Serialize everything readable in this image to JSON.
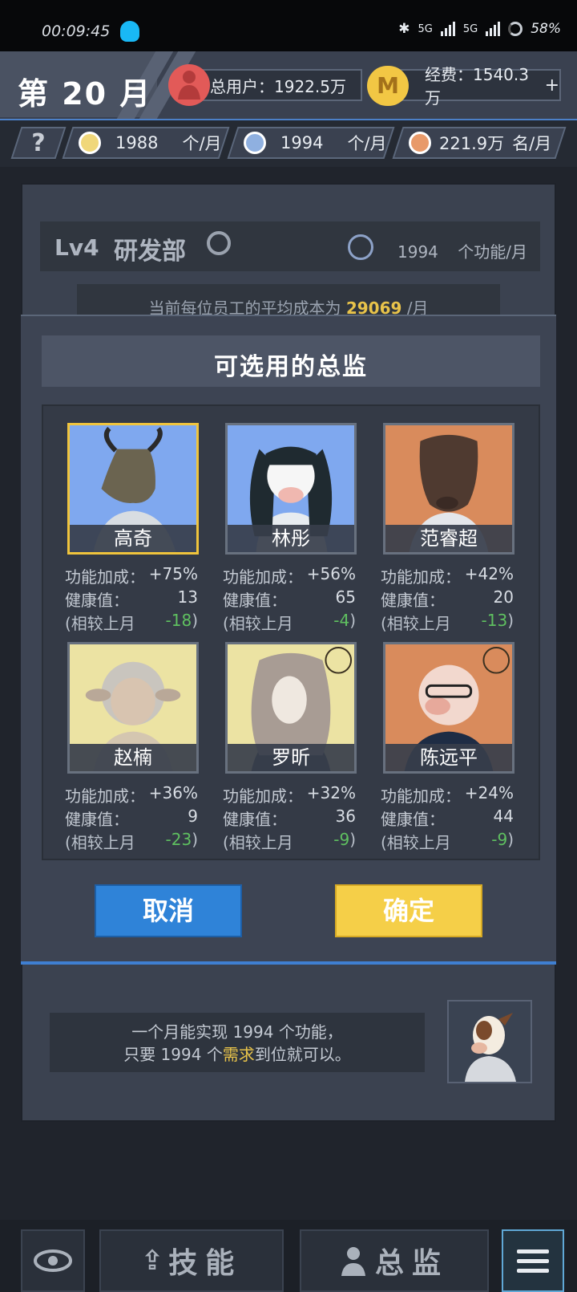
{
  "status_bar": {
    "time": "00:09:45",
    "network1": "5G",
    "network2": "5G",
    "battery": "58%"
  },
  "header": {
    "month": "第 20 月",
    "total_users": "总用户：1922.5万",
    "funds": "经费：1540.3万",
    "add_funds_label": "+",
    "coin_glyph": "M"
  },
  "rates": {
    "help_label": "?",
    "ideas": {
      "value": "1988",
      "unit": "个/月"
    },
    "features": {
      "value": "1994",
      "unit": "个/月"
    },
    "users": {
      "value": "221.9万",
      "unit": "名/月"
    }
  },
  "department": {
    "level": "Lv4",
    "name": "研发部",
    "rate_value": "1994",
    "rate_unit": "个功能/月",
    "avg_cost_prefix": "当前每位员工的平均成本为",
    "avg_cost_value": "29069",
    "avg_cost_suffix": "/月"
  },
  "modal": {
    "title": "可选用的总监",
    "bonus_label": "功能加成：",
    "health_label": "健康值：",
    "compare_label": "(相较上月",
    "compare_close": ")",
    "directors": [
      {
        "name": "高奇",
        "bonus": "+75%",
        "health": "13",
        "change": "-18",
        "selected": true,
        "bg": "#7fa8ef",
        "animal": "bull"
      },
      {
        "name": "林彤",
        "bonus": "+56%",
        "health": "65",
        "change": "-4",
        "selected": false,
        "bg": "#7fa8ef",
        "animal": "cow"
      },
      {
        "name": "范睿超",
        "bonus": "+42%",
        "health": "20",
        "change": "-13",
        "selected": false,
        "bg": "#d98b5c",
        "animal": "boar"
      },
      {
        "name": "赵楠",
        "bonus": "+36%",
        "health": "9",
        "change": "-23",
        "selected": false,
        "bg": "#ece3a3",
        "animal": "sheep"
      },
      {
        "name": "罗昕",
        "bonus": "+32%",
        "health": "36",
        "change": "-9",
        "selected": false,
        "bg": "#ece3a3",
        "animal": "goat"
      },
      {
        "name": "陈远平",
        "bonus": "+24%",
        "health": "44",
        "change": "-9",
        "selected": false,
        "bg": "#d98b5c",
        "animal": "pig"
      }
    ],
    "cancel_label": "取消",
    "confirm_label": "确定"
  },
  "tip": {
    "line1_a": "一个月能实现",
    "line1_num": "1994",
    "line1_b": "个功能，",
    "line2_a": "只要",
    "line2_num": "1994",
    "line2_b": "个",
    "line2_hl": "需求",
    "line2_c": "到位就可以。"
  },
  "nav": {
    "skill_label": "技能",
    "director_label": "总监"
  },
  "colors": {
    "accent_blue": "#2f83d8",
    "accent_yellow": "#f5cf48",
    "selected_border": "#f0c43c",
    "negative_change": "#5fc060"
  }
}
